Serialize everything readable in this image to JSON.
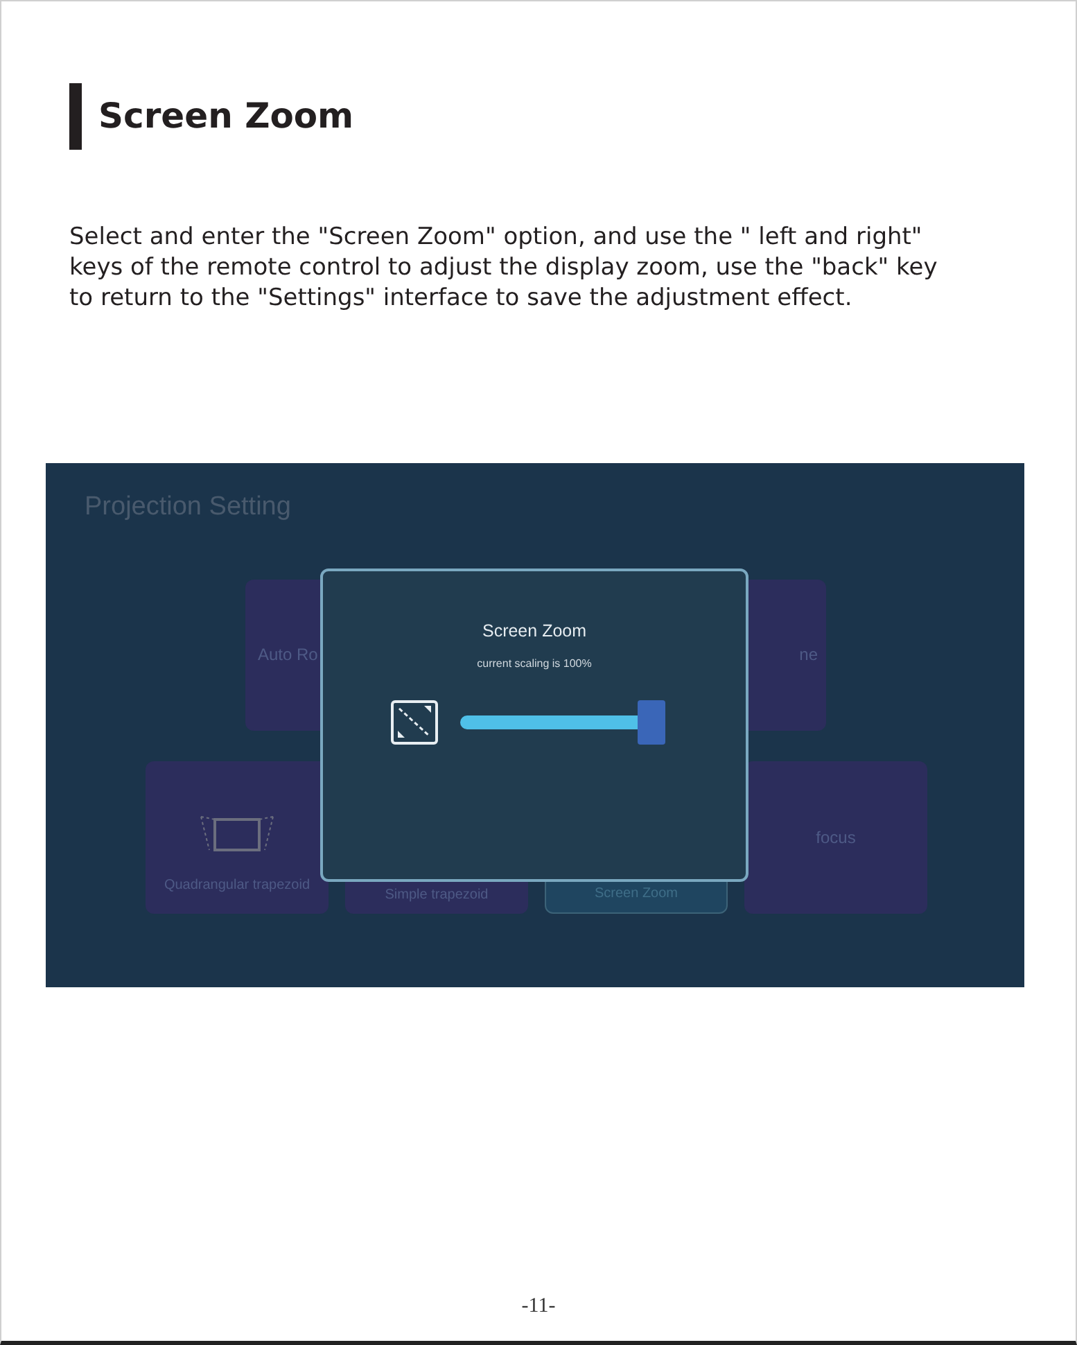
{
  "heading": "Screen Zoom",
  "paragraph": "Select and enter the \"Screen Zoom\" option, and use the \" left and right\" keys of the remote control to adjust the display zoom, use the \"back\" key to return to the \"Settings\" interface to save the adjustment effect.",
  "screenshot": {
    "title": "Projection Setting",
    "top_tiles": [
      {
        "label": "Auto Ro"
      },
      {
        "label": "ne"
      }
    ],
    "bottom_tiles": [
      {
        "label": "Quadrangular trapezoid",
        "kind": "trapezoid",
        "selected": false
      },
      {
        "label": "Simple trapezoid",
        "kind": "bottom-label",
        "selected": false
      },
      {
        "label": "Screen Zoom",
        "kind": "bottom-label",
        "selected": true
      },
      {
        "label": "focus",
        "kind": "center-label",
        "selected": false
      }
    ],
    "dialog": {
      "title": "Screen Zoom",
      "subtitle": "current scaling is 100%"
    }
  },
  "page_number": "-11-"
}
